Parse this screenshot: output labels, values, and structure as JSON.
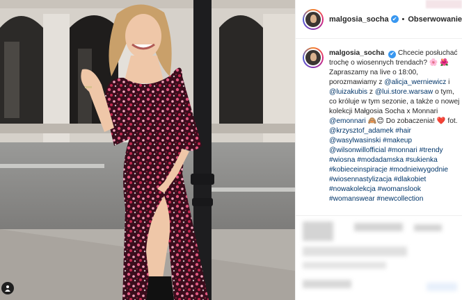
{
  "post": {
    "username": "malgosia_socha",
    "verified_mark": "✔",
    "separator": "•",
    "follow_label": "Obserwowanie"
  },
  "caption": {
    "username": "malgosia_socha",
    "segments": [
      {
        "t": "Chcecie posłuchać trochę o wiosennych trendach? "
      },
      {
        "t": "🌸 🌺"
      },
      {
        "t": " Zapraszamy na live o 18:00, porozmawiamy z "
      },
      {
        "t": "@alicja_werniewicz",
        "link": true
      },
      {
        "t": " i "
      },
      {
        "t": "@luizakubis",
        "link": true
      },
      {
        "t": " z "
      },
      {
        "t": "@lui.store.warsaw",
        "link": true
      },
      {
        "t": " o tym, co króluje w tym sezonie, a także o nowej kolekcji Małgosia Socha x Monnari "
      },
      {
        "t": "@emonnari",
        "link": true
      },
      {
        "t": " 🙈😊 Do zobaczenia! "
      },
      {
        "t": "❤️"
      },
      {
        "t": " fot. "
      },
      {
        "t": "@krzysztof_adamek",
        "link": true
      },
      {
        "t": " "
      },
      {
        "t": "#hair",
        "link": true
      },
      {
        "t": " "
      },
      {
        "t": "@wasylwasinski",
        "link": true
      },
      {
        "t": " "
      },
      {
        "t": "#makeup",
        "link": true
      },
      {
        "t": " "
      },
      {
        "t": "@wilsonwillofficial",
        "link": true
      },
      {
        "t": " "
      },
      {
        "t": "#monnari",
        "link": true
      },
      {
        "t": " "
      },
      {
        "t": "#trendy",
        "link": true
      },
      {
        "t": " "
      },
      {
        "t": "#wiosna",
        "link": true
      },
      {
        "t": " "
      },
      {
        "t": "#modadamska",
        "link": true
      },
      {
        "t": " "
      },
      {
        "t": "#sukienka",
        "link": true
      },
      {
        "t": " "
      },
      {
        "t": "#kobieceinspiracje",
        "link": true
      },
      {
        "t": " "
      },
      {
        "t": "#modnieiwygodnie",
        "link": true
      },
      {
        "t": " "
      },
      {
        "t": "#wiosennastylizacja",
        "link": true
      },
      {
        "t": " "
      },
      {
        "t": "#dlakobiet",
        "link": true
      },
      {
        "t": " "
      },
      {
        "t": "#nowakolekcja",
        "link": true
      },
      {
        "t": " "
      },
      {
        "t": "#womanslook",
        "link": true
      },
      {
        "t": " "
      },
      {
        "t": "#womanswear",
        "link": true
      },
      {
        "t": " "
      },
      {
        "t": "#newcollection",
        "link": true
      }
    ]
  },
  "icons": {
    "tag": "user-tag-icon",
    "verified": "verified-badge-icon"
  },
  "colors": {
    "link": "#003569",
    "verified": "#3897f0",
    "text": "#262626"
  }
}
